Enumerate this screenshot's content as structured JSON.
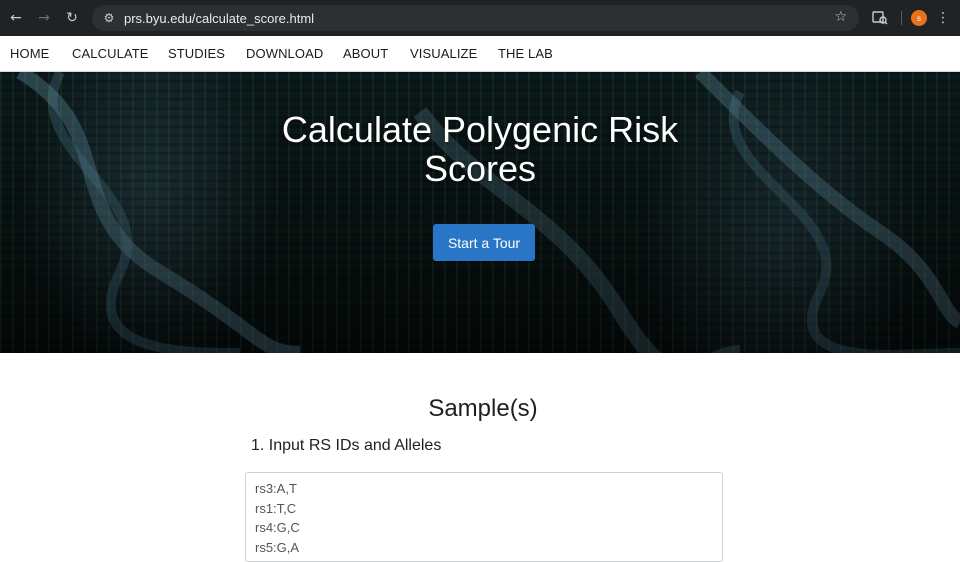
{
  "browser": {
    "url": "prs.byu.edu/calculate_score.html",
    "profile_initial": "s",
    "icons": {
      "back": "arrow-left-icon",
      "forward": "arrow-right-icon",
      "reload": "reload-icon",
      "site_info": "tune-icon",
      "bookmark": "star-icon",
      "extension": "extension-icon",
      "menu": "more-vert-icon"
    }
  },
  "nav": {
    "items": [
      "HOME",
      "CALCULATE",
      "STUDIES",
      "DOWNLOAD",
      "ABOUT",
      "VISUALIZE",
      "THE LAB"
    ]
  },
  "hero": {
    "title_line1": "Calculate Polygenic Risk",
    "title_line2": "Scores",
    "tour_button": "Start a Tour"
  },
  "samples": {
    "heading": "Sample(s)",
    "step1_title": "1. Input RS IDs and Alleles",
    "textarea_lines": [
      "rs3:A,T",
      "rs1:T,C",
      "rs4:G,C",
      "rs5:G,A"
    ]
  },
  "colors": {
    "chrome_bg": "#1f2326",
    "omnibox_bg": "#2b3034",
    "primary_button": "#2a76c6",
    "profile_badge": "#e8711c"
  }
}
